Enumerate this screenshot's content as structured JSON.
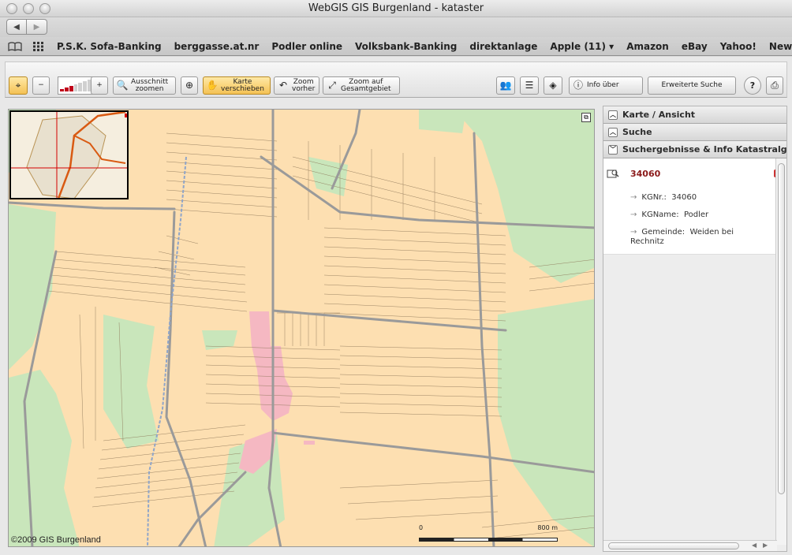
{
  "window": {
    "title": "WebGIS GIS Burgenland - kataster"
  },
  "bookmarks": [
    {
      "label": "P.S.K. Sofa-Banking"
    },
    {
      "label": "berggasse.at.nr"
    },
    {
      "label": "Podler online"
    },
    {
      "label": "Volksbank-Banking"
    },
    {
      "label": "direktanlage"
    },
    {
      "label": "Apple (11) ▾"
    },
    {
      "label": "Amazon"
    },
    {
      "label": "eBay"
    },
    {
      "label": "Yahoo!"
    },
    {
      "label": "News ▾"
    }
  ],
  "toolbar": {
    "zoom_out": "−",
    "zoom_in": "+",
    "ausschnitt_1": "Ausschnitt",
    "ausschnitt_2": "zoomen",
    "karte_1": "Karte",
    "karte_2": "verschieben",
    "zoomvorher_1": "Zoom",
    "zoomvorher_2": "vorher",
    "gesamt_1": "Zoom auf",
    "gesamt_2": "Gesamtgebiet",
    "info": "Info über",
    "erweitert": "Erweiterte Suche",
    "help": "?"
  },
  "map": {
    "copyright": "©2009 GIS Burgenland",
    "scale_start": "0",
    "scale_end": "800 m",
    "colors": {
      "field": "#fddfb1",
      "meadow": "#c9e6bb",
      "built": "#f5b8c2",
      "road": "#9a9a9a",
      "water": "#8fa5c9"
    }
  },
  "panel": {
    "sections": [
      {
        "label": "Karte / Ansicht",
        "state": "collapsed"
      },
      {
        "label": "Suche",
        "state": "collapsed"
      },
      {
        "label": "Suchergebnisse & Info Katastralgemeinden",
        "state": "expanded"
      }
    ],
    "result": {
      "id": "34060",
      "kgnr_label": "KGNr.:",
      "kgnr_value": "34060",
      "kgname_label": "KGName:",
      "kgname_value": "Podler",
      "gemeinde_label": "Gemeinde:",
      "gemeinde_value": "Weiden bei Rechnitz"
    }
  }
}
